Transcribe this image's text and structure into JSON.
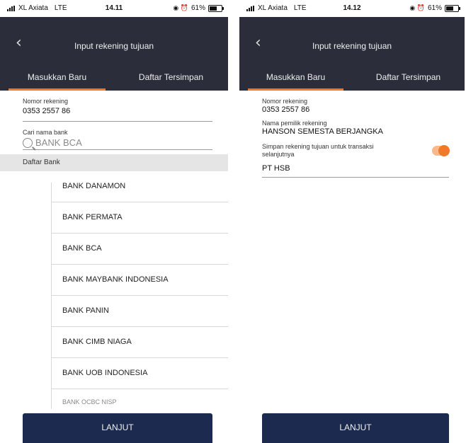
{
  "left": {
    "status": {
      "carrier": "XL Axiata",
      "network": "LTE",
      "time": "14.11",
      "battery": "61%"
    },
    "header": {
      "title": "Input rekening tujuan"
    },
    "tabs": [
      {
        "label": "Masukkan Baru"
      },
      {
        "label": "Daftar Tersimpan"
      }
    ],
    "account": {
      "label": "Nomor rekening",
      "value": "0353 2557 86"
    },
    "search": {
      "label": "Cari nama bank",
      "placeholder": "BANK BCA"
    },
    "list": {
      "header": "Daftar Bank",
      "items": [
        "BANK DANAMON",
        "BANK PERMATA",
        "BANK BCA",
        "BANK MAYBANK INDONESIA",
        "BANK PANIN",
        "BANK CIMB NIAGA",
        "BANK UOB INDONESIA",
        "BANK OCBC NISP"
      ]
    },
    "cta": "LANJUT"
  },
  "right": {
    "status": {
      "carrier": "XL Axiata",
      "network": "LTE",
      "time": "14.12",
      "battery": "61%"
    },
    "header": {
      "title": "Input rekening tujuan"
    },
    "tabs": [
      {
        "label": "Masukkan Baru"
      },
      {
        "label": "Daftar Tersimpan"
      }
    ],
    "account": {
      "label": "Nomor rekening",
      "value": "0353 2557 86"
    },
    "owner": {
      "label": "Nama pemilik rekening",
      "value": "HANSON SEMESTA BERJANGKA"
    },
    "save": {
      "label": "Simpan rekening tujuan untuk transaksi selanjutnya",
      "enabled": true
    },
    "alias": {
      "value": "PT HSB"
    },
    "cta": "LANJUT"
  },
  "colors": {
    "header_bg": "#2b2e3a",
    "accent": "#f07a2a",
    "button_bg": "#1b2a4e"
  }
}
